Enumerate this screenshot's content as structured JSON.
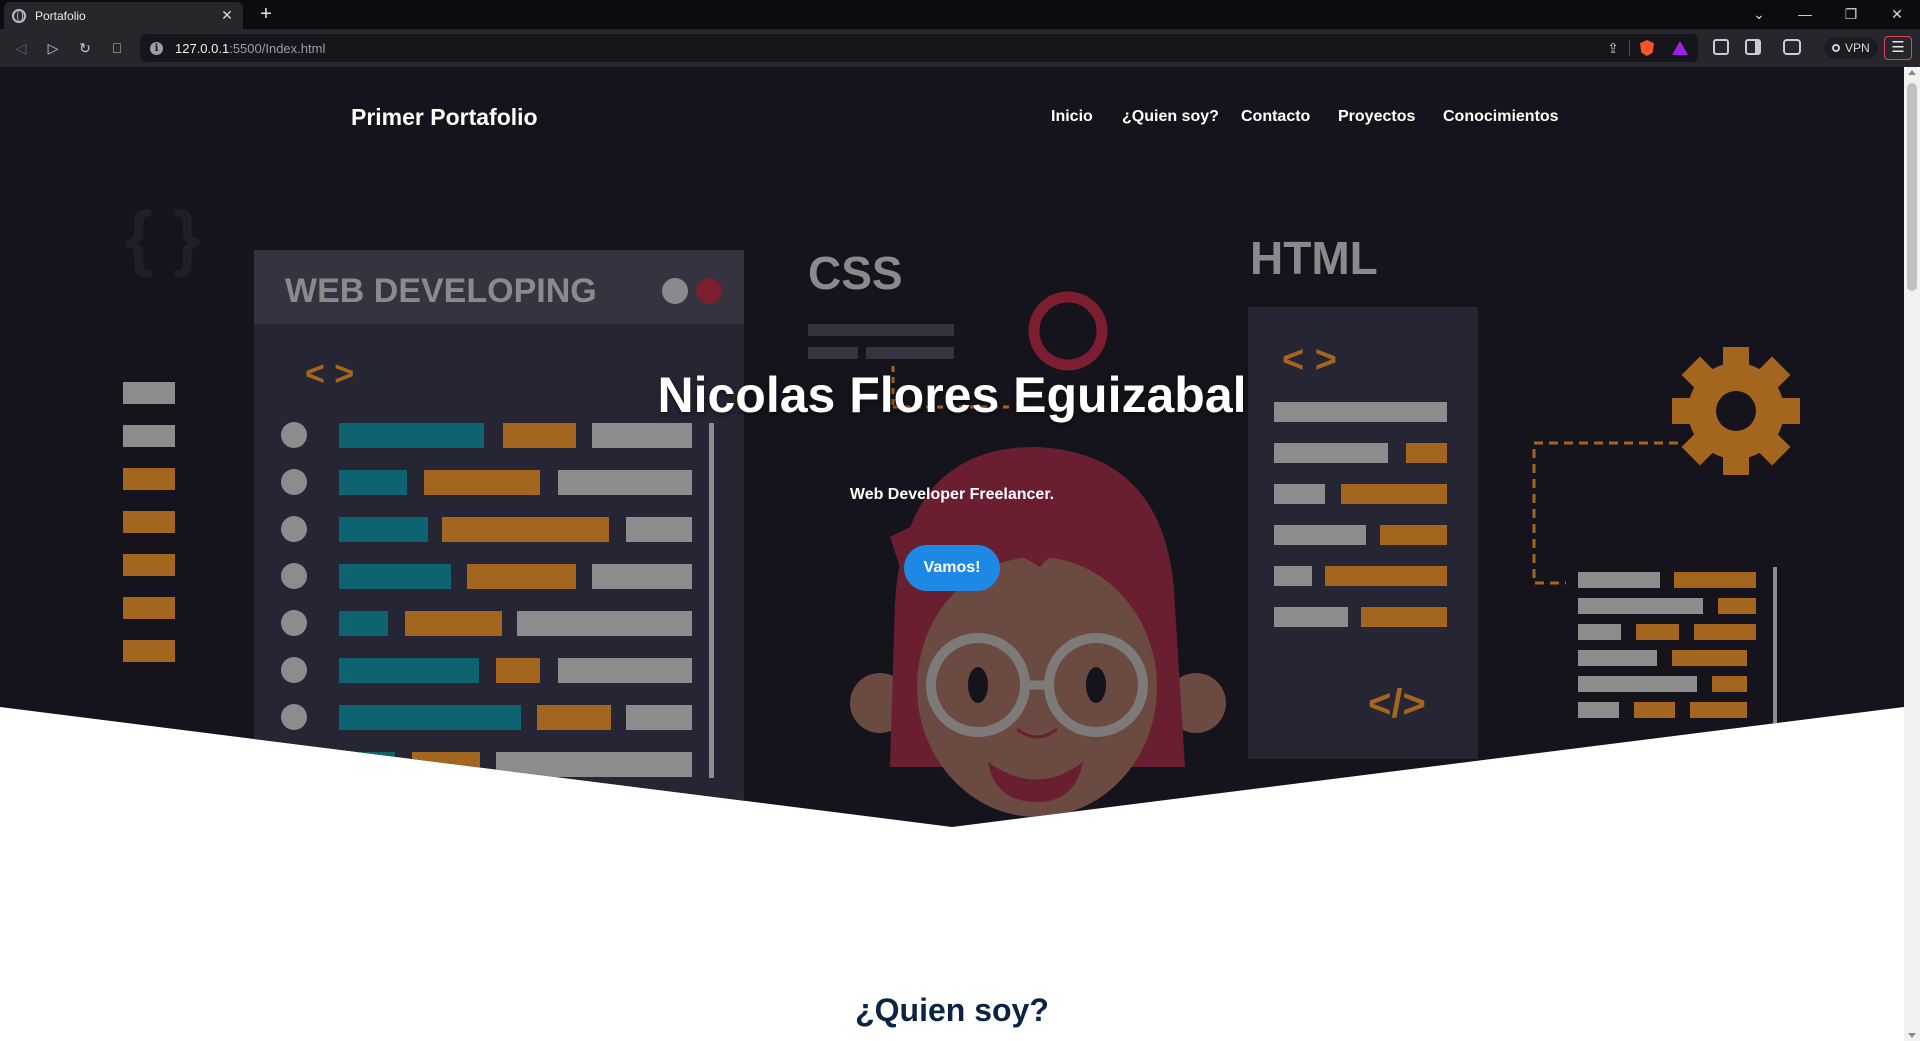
{
  "browser": {
    "tab_title": "Portafolio",
    "tab_close": "✕",
    "new_tab": "+",
    "url_host": "127.0.0.1",
    "url_path": ":5500/Index.html",
    "vpn_label": "VPN",
    "window_controls": [
      "⌄",
      "—",
      "❐",
      "✕"
    ]
  },
  "site": {
    "brand": "Primer Portafolio",
    "nav": [
      "Inicio",
      "¿Quien soy?",
      "Contacto",
      "Proyectos",
      "Conocimientos"
    ],
    "hero": {
      "title": "Nicolas Flores Eguizabal",
      "subtitle": "Web Developer Freelancer.",
      "cta": "Vamos!"
    },
    "section_title": "¿Quien soy?",
    "illustration": {
      "panel_label": "WEB DEVELOPING",
      "css_label": "CSS",
      "html_label": "HTML",
      "open_tag": "< >",
      "close_tag": "</>",
      "braces": "{ }"
    }
  },
  "colors": {
    "hero_bg": "#15141c",
    "cta_bg": "#1e88e5",
    "section_title": "#0b2444",
    "accent_orange": "#a4651f",
    "accent_teal": "#0d6470",
    "accent_red": "#7a1e30"
  }
}
